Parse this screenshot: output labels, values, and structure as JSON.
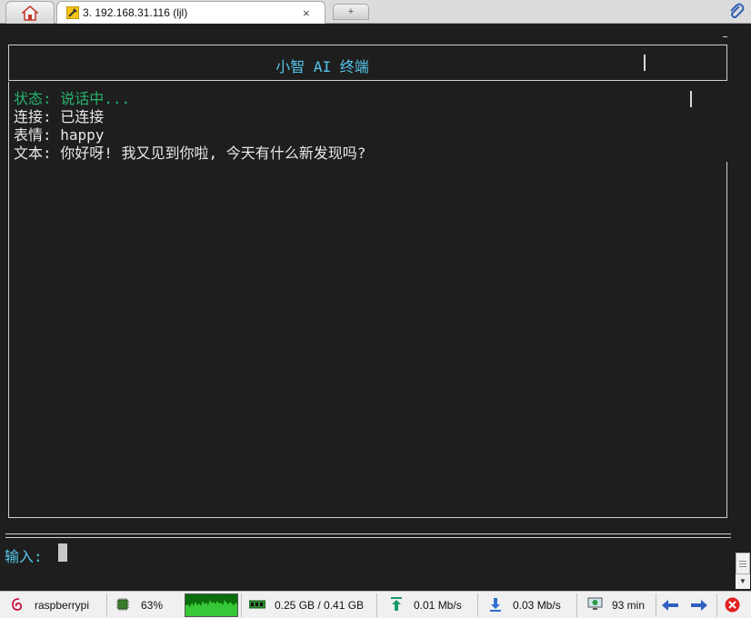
{
  "tabs": {
    "home_icon": "home-icon",
    "session_title": "3. 192.168.31.116 (ljl)",
    "session_icon": "wrench-icon",
    "close_glyph": "×",
    "new_tab_glyph": "+",
    "attach_icon": "paperclip-icon"
  },
  "terminal": {
    "title": "小智 AI 终端",
    "title_color": "#55c5e8",
    "status_line": "状态: 说话中...",
    "status_color": "#27b46a",
    "connection_line": "连接: 已连接",
    "emotion_line": "表情: happy",
    "text_line": "文本: 你好呀! 我又见到你啦, 今天有什么新发现吗?",
    "input_label": "输入:",
    "background": "#1e1e1e"
  },
  "statusbar": {
    "host": "raspberrypi",
    "cpu": "63%",
    "memory": "0.25 GB / 0.41 GB",
    "upload": "0.01 Mb/s",
    "download": "0.03 Mb/s",
    "uptime": "93 min",
    "icons": [
      "debian-icon",
      "cpu-icon",
      "cpu-graph",
      "memory-icon",
      "upload-arrow-icon",
      "download-arrow-icon",
      "monitor-icon",
      "arrow-left-icon",
      "arrow-right-icon",
      "close-circle-icon"
    ]
  }
}
